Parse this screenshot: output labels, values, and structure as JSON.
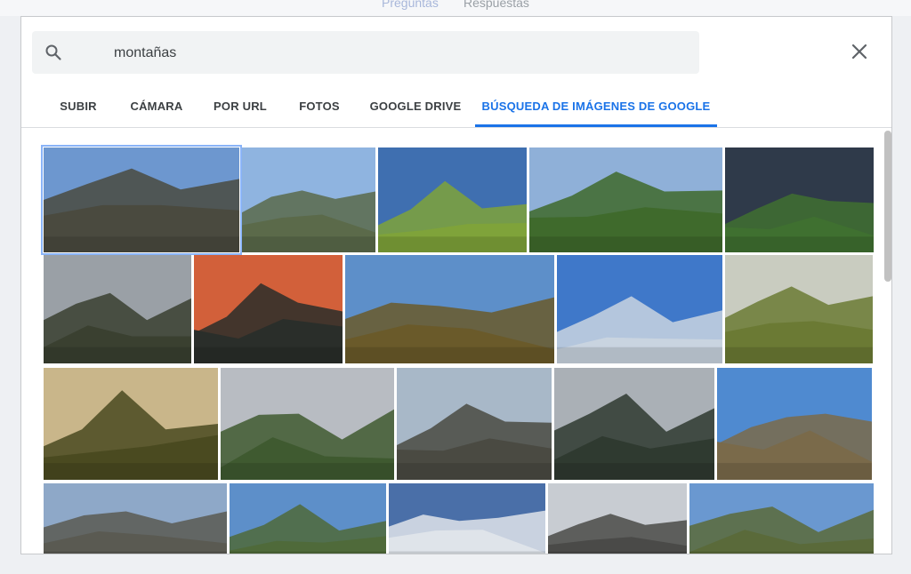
{
  "background_nav": {
    "questions_label": "Preguntas",
    "answers_label": "Respuestas"
  },
  "search": {
    "value": "montañas",
    "placeholder": ""
  },
  "tabs": [
    {
      "label": "SUBIR"
    },
    {
      "label": "CÁMARA"
    },
    {
      "label": "POR URL"
    },
    {
      "label": "FOTOS"
    },
    {
      "label": "GOOGLE DRIVE"
    },
    {
      "label": "BÚSQUEDA DE IMÁGENES DE GOOGLE",
      "active": true
    }
  ],
  "icons": {
    "search": "search-icon",
    "close": "close-icon"
  },
  "colors": {
    "accent": "#1a73e8",
    "tab_text": "#3c4043",
    "search_bg": "#f1f3f4"
  },
  "image_results": [
    {
      "sky": "#6d97cf",
      "land": "#4a4a3f",
      "row": 1
    },
    {
      "sky": "#8fb4e0",
      "land": "#5b6a4a",
      "row": 1
    },
    {
      "sky": "#3f6fb0",
      "land": "#7fa33a",
      "row": 1
    },
    {
      "sky": "#8fb0d8",
      "land": "#3f6a2c",
      "row": 1
    },
    {
      "sky": "#2f3a4a",
      "land": "#3f7030",
      "row": 1
    },
    {
      "sky": "#9aa0a6",
      "land": "#3a4030",
      "row": 2
    },
    {
      "sky": "#d2603a",
      "land": "#2a2e2a",
      "row": 2
    },
    {
      "sky": "#5d8fc9",
      "land": "#6a5a2a",
      "row": 2
    },
    {
      "sky": "#3f78c9",
      "land": "#c9d4e0",
      "row": 2
    },
    {
      "sky": "#c9ccc0",
      "land": "#6b7a34",
      "row": 2
    },
    {
      "sky": "#c9b68a",
      "land": "#4a4a20",
      "row": 3
    },
    {
      "sky": "#b8bcc2",
      "land": "#3f5a30",
      "row": 3
    },
    {
      "sky": "#a8b8c8",
      "land": "#4a4a42",
      "row": 3
    },
    {
      "sky": "#aab0b6",
      "land": "#2f3a30",
      "row": 3
    },
    {
      "sky": "#4f8ad0",
      "land": "#7a6a4a",
      "row": 3
    },
    {
      "sky": "#8ea8c8",
      "land": "#5a5a52",
      "row": 4
    },
    {
      "sky": "#5d8fc9",
      "land": "#4f6a3a",
      "row": 4
    },
    {
      "sky": "#4a6fa8",
      "land": "#dfe4ea",
      "row": 4
    },
    {
      "sky": "#c8ccd2",
      "land": "#4a4a48",
      "row": 4
    },
    {
      "sky": "#6a98d0",
      "land": "#5a6a3a",
      "row": 4
    }
  ]
}
